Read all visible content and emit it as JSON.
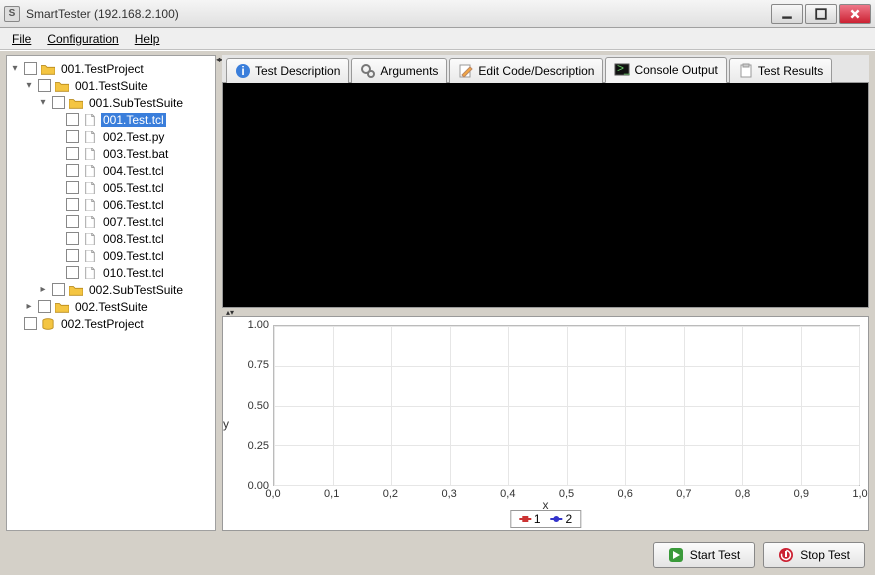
{
  "window": {
    "title": "SmartTester (192.168.2.100)"
  },
  "menu": {
    "file": "File",
    "configuration": "Configuration",
    "help": "Help"
  },
  "tree": {
    "project": "001.TestProject",
    "suite1": "001.TestSuite",
    "subsuite1": "001.SubTestSuite",
    "tests": [
      "001.Test.tcl",
      "002.Test.py",
      "003.Test.bat",
      "004.Test.tcl",
      "005.Test.tcl",
      "006.Test.tcl",
      "007.Test.tcl",
      "008.Test.tcl",
      "009.Test.tcl",
      "010.Test.tcl"
    ],
    "subsuite2": "002.SubTestSuite",
    "suite2": "002.TestSuite",
    "project2": "002.TestProject"
  },
  "tabs": {
    "desc": "Test Description",
    "args": "Arguments",
    "edit": "Edit Code/Description",
    "console": "Console Output",
    "results": "Test Results"
  },
  "buttons": {
    "start": "Start Test",
    "stop": "Stop Test"
  },
  "chart_data": {
    "type": "line",
    "title": "",
    "xlabel": "x",
    "ylabel": "y",
    "xlim": [
      0.0,
      1.0
    ],
    "ylim": [
      0.0,
      1.0
    ],
    "xticks": [
      0.0,
      0.1,
      0.2,
      0.3,
      0.4,
      0.5,
      0.6,
      0.7,
      0.8,
      0.9,
      1.0
    ],
    "yticks": [
      0.0,
      0.25,
      0.5,
      0.75,
      1.0
    ],
    "series": [
      {
        "name": "1",
        "color": "#c33",
        "values": []
      },
      {
        "name": "2",
        "color": "#33c",
        "values": []
      }
    ]
  }
}
